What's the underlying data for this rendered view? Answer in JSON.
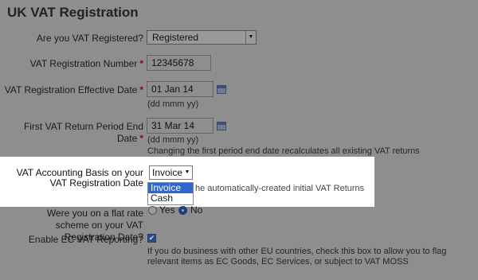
{
  "page": {
    "title": "UK VAT Registration"
  },
  "fields": {
    "registered": {
      "label": "Are you VAT Registered?",
      "value": "Registered"
    },
    "reg_number": {
      "label": "VAT Registration Number",
      "required": "*",
      "value": "12345678"
    },
    "effective_date": {
      "label": "VAT Registration Effective Date",
      "required": "*",
      "value": "01 Jan 14",
      "hint": "(dd mmm yy)"
    },
    "first_return": {
      "label": "First VAT Return Period End Date",
      "required": "*",
      "value": "31 Mar 14",
      "hint": "(dd mmm yy)",
      "note": "Changing the first period end date recalculates all existing VAT returns"
    },
    "accounting_basis": {
      "label": "VAT Accounting Basis on your VAT Registration Date",
      "value": "Invoice",
      "options": [
        "Invoice",
        "Cash"
      ],
      "partial_hint": "he automatically-created initial VAT Returns"
    },
    "flat_rate": {
      "label": "Were you on a flat rate scheme on your VAT Registration Date?",
      "yes": "Yes",
      "no": "No",
      "selected": "No"
    },
    "ec_vat": {
      "label": "Enable EC VAT Reporting?",
      "checked": true,
      "hint": "If you do business with other EU countries, check this box to allow you to flag relevant items as EC Goods, EC Services, or subject to VAT MOSS"
    }
  }
}
